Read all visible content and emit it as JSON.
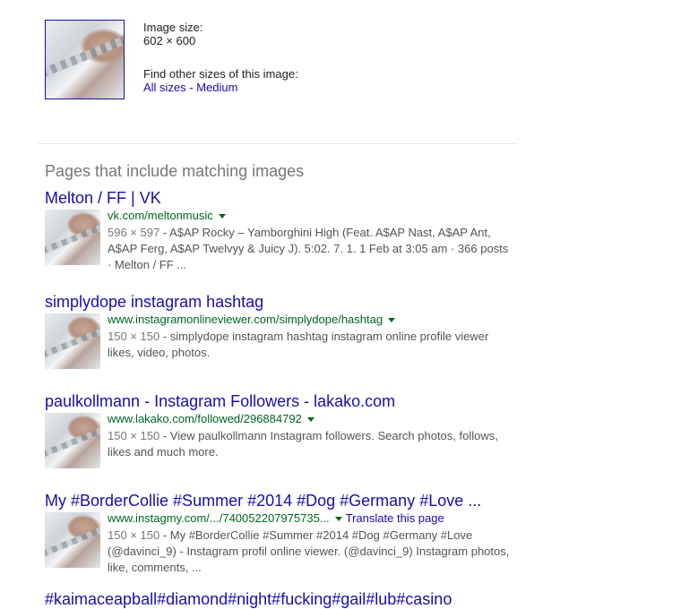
{
  "image_info": {
    "size_label": "Image size:",
    "size_value": "602 × 600",
    "find_label": "Find other sizes of this image:",
    "all_sizes": "All sizes",
    "separator": " - ",
    "medium": "Medium"
  },
  "section_title": "Pages that include matching images",
  "results": [
    {
      "title": "Melton / FF | VK",
      "url": "vk.com/meltonmusic",
      "dims": "596 × 597",
      "snippet_lines": [
        " - A$AP Rocky – Yamborghini High (Feat. A$AP Nast, A$AP Ant,",
        "A$AP Ferg, A$AP Twelvyy & Juicy J). 5:02. 7. 1. 1 Feb at 3:05 am · 366 posts",
        "· Melton / FF ..."
      ]
    },
    {
      "title": "simplydope instagram hashtag",
      "url": "www.instagramonlineviewer.com/simplydope/hashtag",
      "dims": "150 × 150",
      "snippet_lines": [
        " - simplydope instagram hashtag instagram online profile viewer",
        "likes, video, photos."
      ]
    },
    {
      "title": "paulkollmann - Instagram Followers - lakako.com",
      "url": "www.lakako.com/followed/296884792",
      "dims": "150 × 150",
      "snippet_lines": [
        " - View paulkollmann Instagram followers. Search photos, follows,",
        "likes and much more."
      ]
    },
    {
      "title": "My #BorderCollie #Summer #2014 #Dog #Germany #Love ...",
      "url": "www.instagmy.com/.../740052207975735...",
      "translate": "Translate this page",
      "dims": "150 × 150",
      "snippet_lines": [
        " - My #BorderCollie #Summer #2014 #Dog #Germany #Love",
        "(@davinci_9) - Instagram profil online viewer. (@davinci_9) Instagram photos,",
        "like, comments, ..."
      ]
    }
  ],
  "partial_next_title": "#kaimaceapball#diamond#night#fucking#gail#lub#casino"
}
